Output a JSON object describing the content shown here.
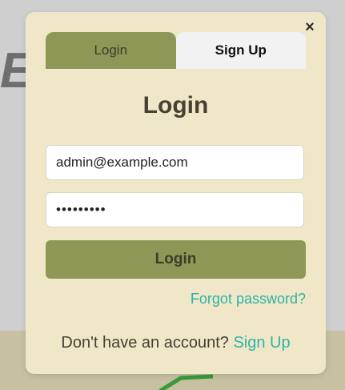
{
  "background": {
    "partial_letter": "E",
    "colors": {
      "page": "#cfcfcf",
      "band": "#c8c1a1",
      "accent_shape": "#3a9a3a"
    }
  },
  "modal": {
    "close_icon": "×",
    "tabs": [
      {
        "label": "Login",
        "active": true
      },
      {
        "label": "Sign Up",
        "active": false
      }
    ],
    "title": "Login",
    "email": {
      "value": "admin@example.com",
      "placeholder": ""
    },
    "password": {
      "value": "•••••••••",
      "placeholder": ""
    },
    "submit_label": "Login",
    "forgot_password": "Forgot password?",
    "footer": {
      "prompt": "Don't have an account?",
      "link": "Sign Up"
    },
    "colors": {
      "panel": "#efe7c8",
      "primary": "#8f9756",
      "link": "#2fb3a8",
      "text": "#474134"
    }
  }
}
